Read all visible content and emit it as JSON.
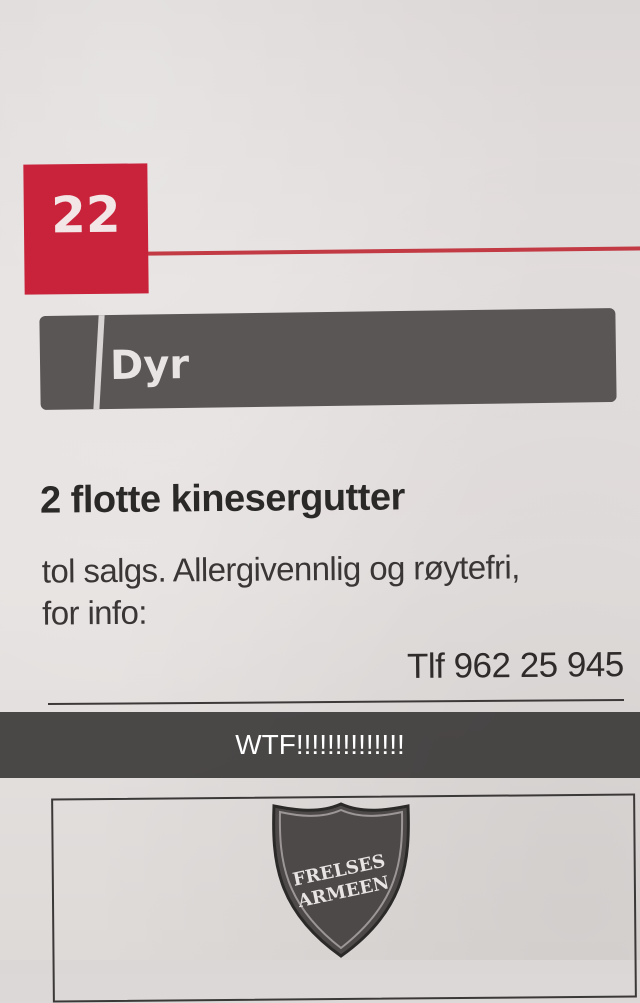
{
  "page": {
    "number": "22"
  },
  "category": {
    "label": "Dyr"
  },
  "ad": {
    "title": "2 flotte kinesergutter",
    "body_line1": "tol salgs. Allergivennlig og røytefri,",
    "body_line2": "for info:",
    "phone": "Tlf 962 25 945"
  },
  "caption": {
    "text": "WTF!!!!!!!!!!!!!!"
  },
  "next_ad": {
    "logo_line1": "FRELSES",
    "logo_line2": "ARMEEN"
  },
  "colors": {
    "page_number_bg": "#c8233a",
    "category_bar": "#5a5656",
    "caption_bg": "#282626"
  }
}
